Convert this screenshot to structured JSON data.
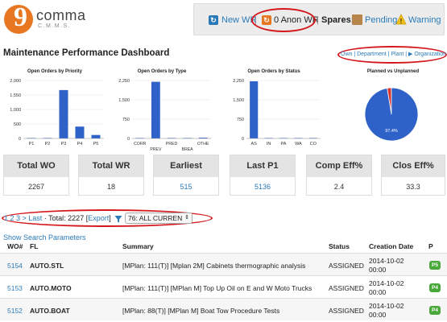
{
  "header": {
    "logo_mark": "9",
    "logo_word": "comma",
    "logo_sub": "C.M.M.S.",
    "new_wr": "New WR",
    "anon_wr": "0 Anon WR",
    "spares_label": "Spares:",
    "pending": "Pending",
    "warning": "Warning",
    "separator": "|"
  },
  "dashboard": {
    "title": "Maintenance Performance Dashboard",
    "breadcrumbs": "Own | Department | Plant | ▶ Organization"
  },
  "chart_data": [
    {
      "type": "bar",
      "title": "Open Orders by Priority",
      "categories": [
        "P1",
        "P2",
        "P3",
        "P4",
        "P5"
      ],
      "values": [
        10,
        15,
        1670,
        410,
        120
      ],
      "ylim": [
        0,
        2000
      ],
      "yticks": [
        "2,000",
        "1,550",
        "1,000",
        "500",
        "0"
      ],
      "grid": true
    },
    {
      "type": "bar",
      "title": "Open Orders by Type",
      "categories": [
        "CORR",
        "PREV",
        "PRED",
        "BREA",
        "OTHE"
      ],
      "tick_labels_row1": [
        "CORR",
        "PRED",
        "OTHE"
      ],
      "tick_labels_row2": [
        "PREV",
        "BREA"
      ],
      "values": [
        5,
        2200,
        10,
        5,
        30
      ],
      "ylim": [
        0,
        2250
      ],
      "yticks": [
        "2,250",
        "1,500",
        "750",
        "0"
      ],
      "grid": true
    },
    {
      "type": "bar",
      "title": "Open Orders by Status",
      "categories": [
        "AS",
        "IN",
        "PA",
        "WA",
        "CO"
      ],
      "values": [
        2220,
        10,
        10,
        10,
        5
      ],
      "ylim": [
        0,
        2250
      ],
      "yticks": [
        "2,250",
        "1,500",
        "750",
        "0"
      ],
      "grid": true
    },
    {
      "type": "pie",
      "title": "Planned vs Unplanned",
      "slices": [
        {
          "value": 97.4,
          "color": "#2f62c9"
        },
        {
          "value": 2.6,
          "color": "#d9352b"
        }
      ],
      "data_label": "97.4%"
    }
  ],
  "kpis": [
    {
      "label": "Total WO",
      "value": "2267",
      "link": false
    },
    {
      "label": "Total WR",
      "value": "18",
      "link": false
    },
    {
      "label": "Earliest",
      "value": "515",
      "link": true
    },
    {
      "label": "Last P1",
      "value": "5136",
      "link": true
    },
    {
      "label": "Comp Eff%",
      "value": "2.4",
      "link": false
    },
    {
      "label": "Clos Eff%",
      "value": "33.3",
      "link": false
    }
  ],
  "pager": {
    "pages": "1 2 3 >",
    "last": "Last",
    "total": "· Total: 2227 [",
    "export": "Export",
    "close": "]",
    "filter_value": "76: ALL CURREN"
  },
  "show_search_params": "Show Search Parameters",
  "table": {
    "headers": {
      "wo": "WO#",
      "fl": "FL",
      "summary": "Summary",
      "status": "Status",
      "created": "Creation Date",
      "p": "P"
    },
    "rows": [
      {
        "wo": "5154",
        "fl": "AUTO.STL",
        "summary": "[MPlan: 111(T)] [Mplan 2M] Cabinets thermographic analysis",
        "status": "ASSIGNED",
        "date": "2014-10-02",
        "time": "00:00",
        "p": "P5"
      },
      {
        "wo": "5153",
        "fl": "AUTO.MOTO",
        "summary": "[MPlan: 111(T)] [MPlan M] Top Up Oil on E and W Moto Trucks",
        "status": "ASSIGNED",
        "date": "2014-10-02",
        "time": "00:00",
        "p": "P4"
      },
      {
        "wo": "5152",
        "fl": "AUTO.BOAT",
        "summary": "[MPlan: 88(T)] [MPlan M] Boat Tow Procedure Tests",
        "status": "ASSIGNED",
        "date": "2014-10-02",
        "time": "00:00",
        "p": "P4"
      }
    ]
  },
  "colors": {
    "accent": "#2a7ab8",
    "bar": "#2f62c9",
    "logo": "#e87722",
    "annotation": "#d4171c",
    "badge": "#4aa83a"
  }
}
